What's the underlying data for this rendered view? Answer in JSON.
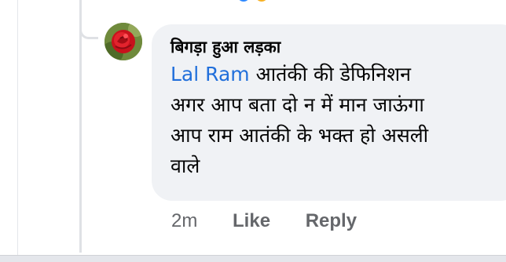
{
  "comment": {
    "author": "बिगड़ा हुआ लड़का",
    "mention": "Lal Ram",
    "lines": [
      " आतंकी की डेफिनिशन",
      "अगर आप बता दो न में मान जाऊंगा",
      "आप राम आतंकी के भक्त हो असली",
      "वाले"
    ],
    "timestamp": "2m",
    "like_label": "Like",
    "reply_label": "Reply"
  },
  "colors": {
    "mention": "#216fdb",
    "bubble": "#f0f2f5",
    "meta": "#65676b"
  },
  "icons": {
    "avatar": "red-rose-avatar",
    "reactions": [
      "like-reaction-icon",
      "haha-reaction-icon"
    ]
  }
}
